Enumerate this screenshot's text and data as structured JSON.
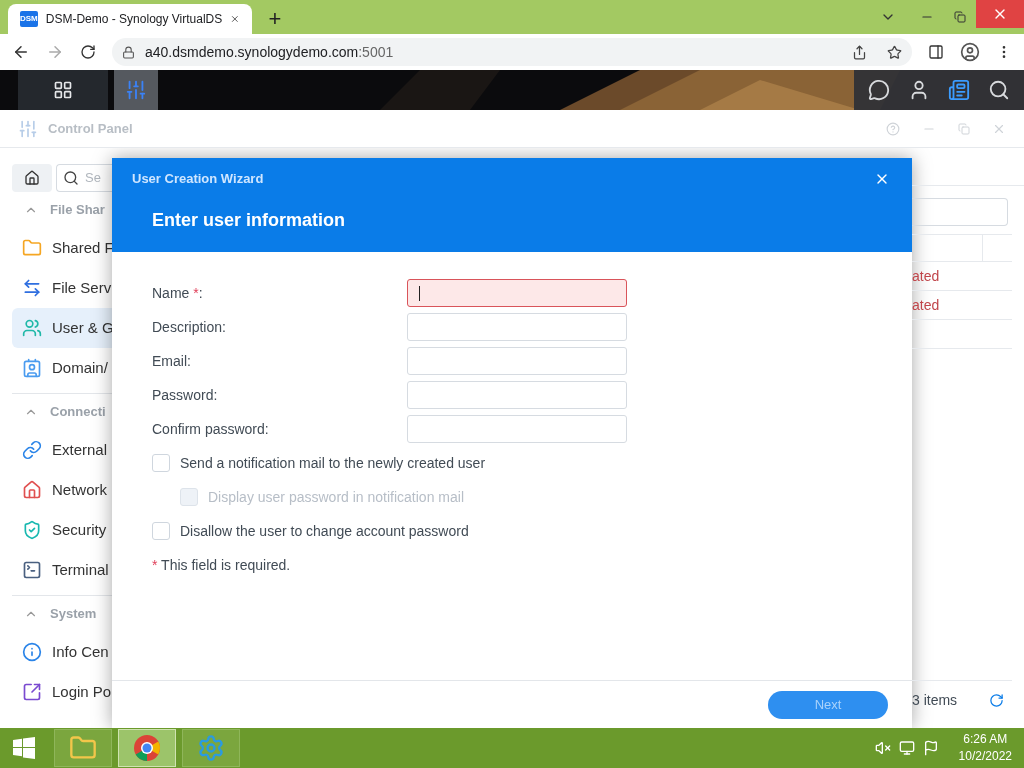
{
  "browser": {
    "tab_title": "DSM-Demo - Synology VirtualDS",
    "favicon": "DSM",
    "new_tab": "+",
    "url_host": "a40.dsmdemo.synologydemo.com",
    "url_port": ":5001"
  },
  "control_panel": {
    "title": "Control Panel",
    "search_placeholder": "Se",
    "sections": [
      {
        "label": "File Shar",
        "expanded": true,
        "items": [
          {
            "label": "Shared F",
            "selected": false
          },
          {
            "label": "File Serv",
            "selected": false
          },
          {
            "label": "User & G",
            "selected": true
          },
          {
            "label": "Domain/",
            "selected": false
          }
        ]
      },
      {
        "label": "Connecti",
        "expanded": true,
        "items": [
          {
            "label": "External",
            "selected": false
          },
          {
            "label": "Network",
            "selected": false
          },
          {
            "label": "Security",
            "selected": false
          },
          {
            "label": "Terminal",
            "selected": false
          }
        ]
      },
      {
        "label": "System",
        "expanded": true,
        "items": [
          {
            "label": "Info Cen",
            "selected": false
          },
          {
            "label": "Login Po",
            "selected": false
          }
        ]
      }
    ],
    "rows": [
      {
        "status": "ated"
      },
      {
        "status": "ated"
      },
      {
        "status": ""
      }
    ],
    "count": "3 items"
  },
  "wizard": {
    "header": "User Creation Wizard",
    "title": "Enter user information",
    "fields": [
      {
        "label": "Name",
        "required_mark": "*",
        "colon": ":",
        "invalid": true,
        "focused": true
      },
      {
        "label": "Description:",
        "invalid": false,
        "focused": false
      },
      {
        "label": "Email:",
        "invalid": false,
        "focused": false
      },
      {
        "label": "Password:",
        "invalid": false,
        "focused": false
      },
      {
        "label": "Confirm password:",
        "invalid": false,
        "focused": false
      }
    ],
    "options": [
      {
        "label": "Send a notification mail to the newly created user",
        "checked": false,
        "disabled": false,
        "children": [
          {
            "label": "Display user password in notification mail",
            "checked": false,
            "disabled": true
          }
        ]
      },
      {
        "label": "Disallow the user to change account password",
        "checked": false,
        "disabled": false
      }
    ],
    "note": {
      "mark": "*",
      "text": "This field is required."
    },
    "next": {
      "label": "Next",
      "disabled": true
    }
  },
  "taskbar": {
    "apps": [
      {
        "kind": "explorer",
        "selected": false
      },
      {
        "kind": "chrome",
        "selected": true
      },
      {
        "kind": "gears",
        "selected": false
      }
    ],
    "time": "6:26 AM",
    "date": "10/2/2022"
  }
}
